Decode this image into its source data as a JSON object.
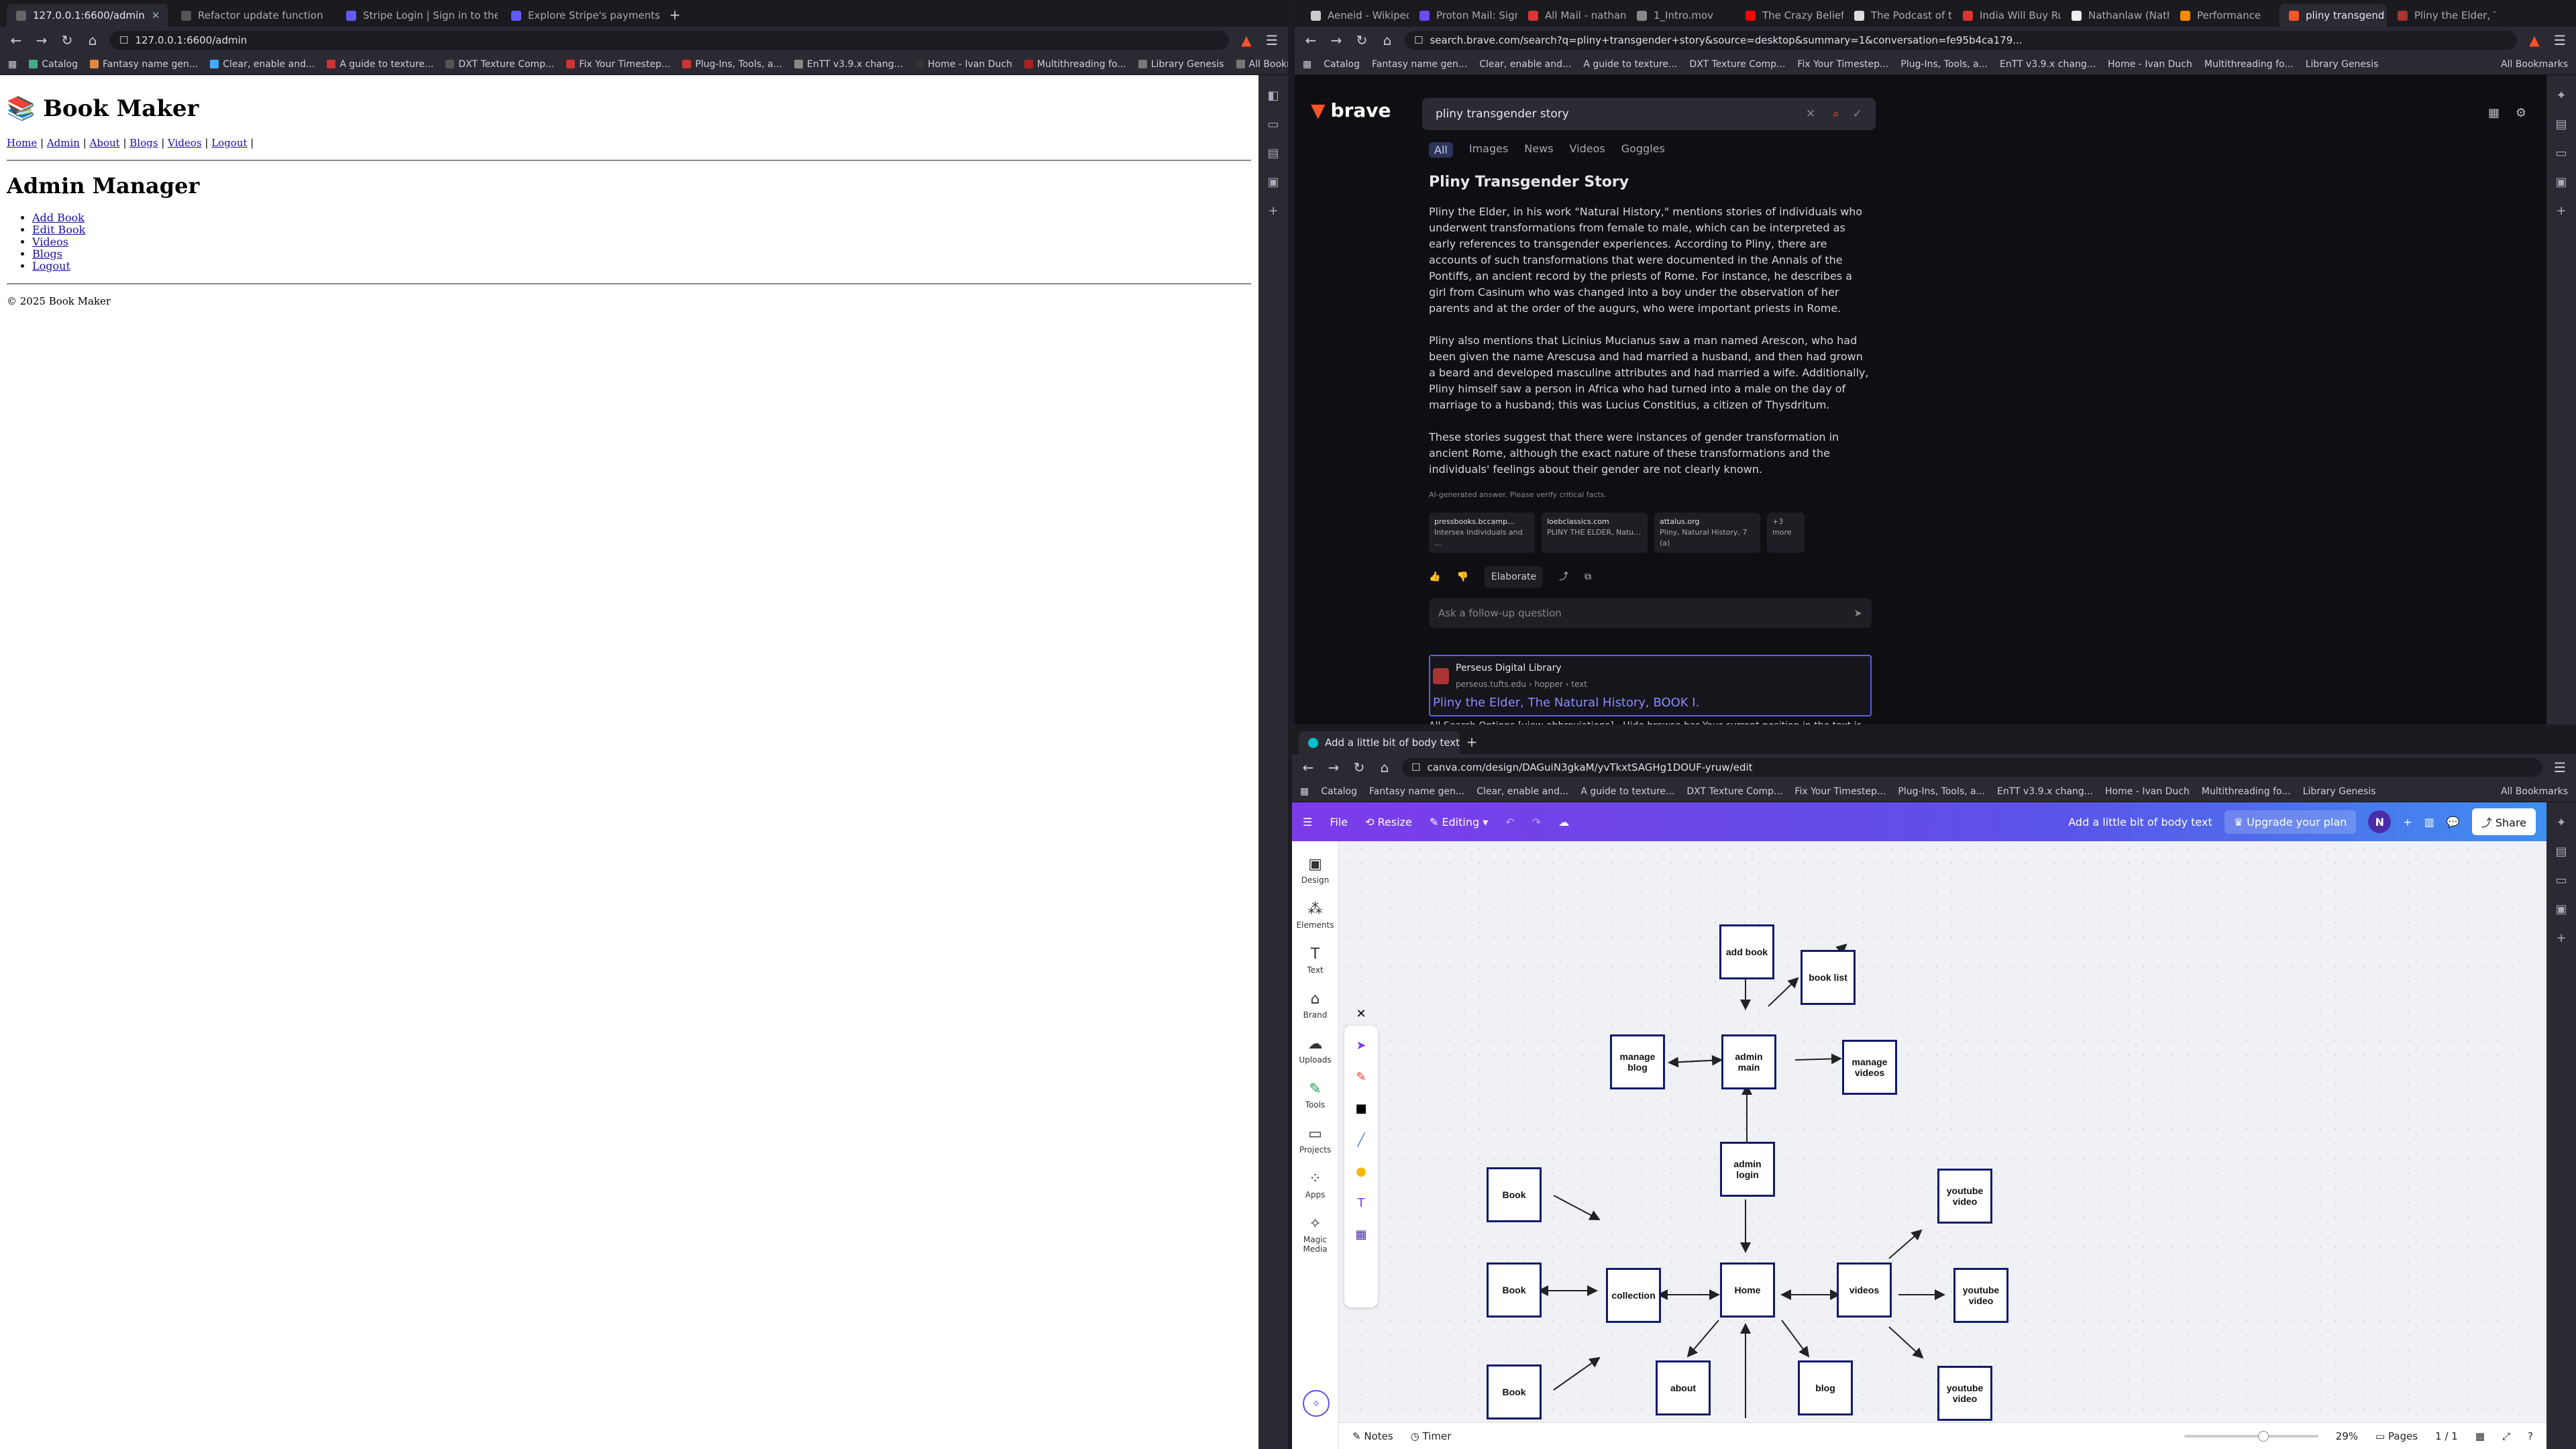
{
  "left_window": {
    "tabs": [
      "127.0.0.1:6600/admin",
      "Refactor update function",
      "Stripe Login | Sign in to the Stripe",
      "Explore Stripe's payments integ"
    ],
    "url": "127.0.0.1:6600/admin",
    "bookmarks": [
      "Catalog",
      "Fantasy name gen...",
      "Clear, enable and...",
      "A guide to texture...",
      "DXT Texture Comp...",
      "Fix Your Timestep...",
      "Plug-Ins, Tools, a...",
      "EnTT v3.9.x chang...",
      "Home - Ivan Duch",
      "Multithreading fo...",
      "Library Genesis"
    ],
    "all_bookmarks": "All Bookmarks",
    "page": {
      "site_title": "Book Maker",
      "nav": [
        "Home",
        "Admin",
        "About",
        "Blogs",
        "Videos",
        "Logout"
      ],
      "heading": "Admin Manager",
      "links": [
        "Add Book",
        "Edit Book",
        "Videos",
        "Blogs",
        "Logout"
      ],
      "footer": "© 2025 Book Maker"
    }
  },
  "brave_window": {
    "tabs": [
      "Aeneid - Wikipedia",
      "Proton Mail: Sign-",
      "All Mail - nathan",
      "1_Intro.mov",
      "The Crazy Beliefs",
      "The Podcast of the",
      "India Will Buy Run",
      "Nathanlaw (Nath",
      "Performance",
      "pliny transgend",
      "Pliny the Elder, Th"
    ],
    "url": "search.brave.com/search?q=pliny+transgender+story&source=desktop&summary=1&conversation=fe95b4ca179...",
    "brand": "brave",
    "query": "pliny transgender story",
    "filters": [
      "All",
      "Images",
      "News",
      "Videos",
      "Goggles"
    ],
    "answer_title": "Pliny Transgender Story",
    "paragraphs": [
      "Pliny the Elder, in his work \"Natural History,\" mentions stories of individuals who underwent transformations from female to male, which can be interpreted as early references to transgender experiences. According to Pliny, there are accounts of such transformations that were documented in the Annals of the Pontiffs, an ancient record by the priests of Rome. For instance, he describes a girl from Casinum who was changed into a boy under the observation of her parents and at the order of the augurs, who were important priests in Rome.",
      "Pliny also mentions that Licinius Mucianus saw a man named Arescon, who had been given the name Arescusa and had married a husband, and then had grown a beard and developed masculine attributes and had married a wife. Additionally, Pliny himself saw a person in Africa who had turned into a male on the day of marriage to a husband; this was Lucius Constitius, a citizen of Thysdritum.",
      "These stories suggest that there were instances of gender transformation in ancient Rome, although the exact nature of these transformations and the individuals' feelings about their gender are not clearly known."
    ],
    "disclaimer": "AI-generated answer. Please verify critical facts.",
    "sources": [
      {
        "site": "pressbooks.bccamp...",
        "text": "Intersex Individuals and ..."
      },
      {
        "site": "loebclassics.com",
        "text": "PLINY THE ELDER, Natu..."
      },
      {
        "site": "attalus.org",
        "text": "Pliny, Natural History, 7 (a)"
      },
      {
        "site": "+3 more",
        "text": ""
      }
    ],
    "elaborate": "Elaborate",
    "followup_placeholder": "Ask a follow-up question",
    "result_site": "Perseus Digital Library",
    "result_path": "perseus.tufts.edu › hopper › text",
    "result_title": "Pliny the Elder, The Natural History, BOOK I.",
    "result_snippet": "All Search Options [view abbreviations] · Hide browse bar Your current position in the text is"
  },
  "canva_window": {
    "tab": "Add a little bit of body text",
    "url": "canva.com/design/DAGuiN3gkaM/yvTkxtSAGHg1DOUF-yruw/edit",
    "menu": [
      "File",
      "Resize",
      "Editing"
    ],
    "doc_title": "Add a little bit of body text",
    "upgrade": "Upgrade your plan",
    "avatar": "N",
    "share": "Share",
    "sidebar": [
      "Design",
      "Elements",
      "Text",
      "Brand",
      "Uploads",
      "Tools",
      "Projects",
      "Apps",
      "Magic Media"
    ],
    "nodes": [
      "add book",
      "book list",
      "manage blog",
      "admin main",
      "manage videos",
      "admin login",
      "Book",
      "Book",
      "Book",
      "collection",
      "Home",
      "videos",
      "youtube video",
      "youtube video",
      "youtube video",
      "about",
      "blog"
    ],
    "footer": {
      "notes": "Notes",
      "timer": "Timer",
      "zoom": "29%",
      "pages": "Pages",
      "page_count": "1 / 1"
    }
  }
}
